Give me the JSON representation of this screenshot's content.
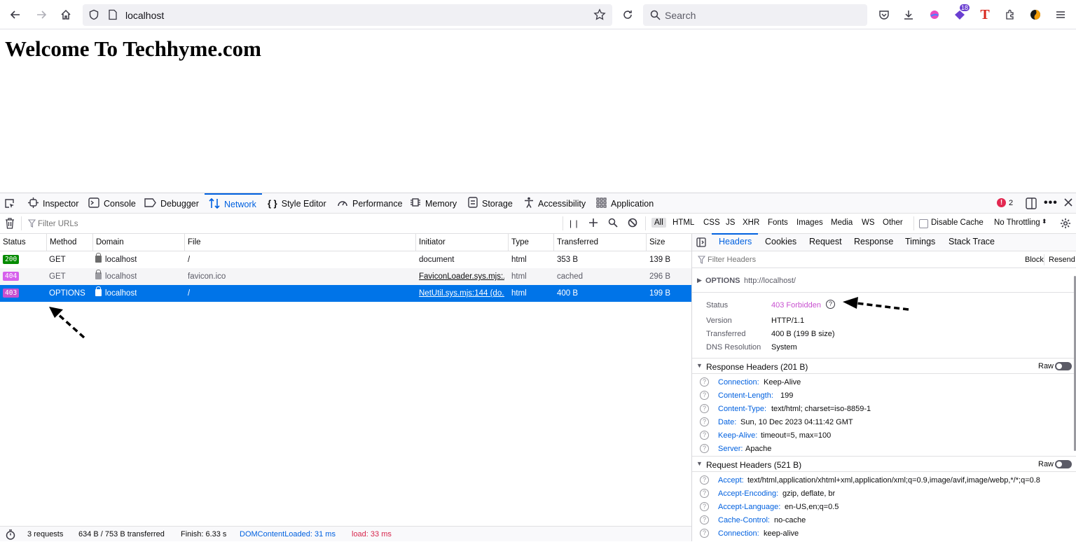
{
  "browser": {
    "url": "localhost",
    "search_placeholder": "Search",
    "ext_badge": "18",
    "ext_letter": "T"
  },
  "page": {
    "heading": "Welcome To Techhyme.com"
  },
  "devtools": {
    "tabs": [
      {
        "label": "Inspector"
      },
      {
        "label": "Console"
      },
      {
        "label": "Debugger"
      },
      {
        "label": "Network"
      },
      {
        "label": "Style Editor"
      },
      {
        "label": "Performance"
      },
      {
        "label": "Memory"
      },
      {
        "label": "Storage"
      },
      {
        "label": "Accessibility"
      },
      {
        "label": "Application"
      }
    ],
    "error_count": "2",
    "filter_placeholder": "Filter URLs",
    "type_filters": [
      "All",
      "HTML",
      "CSS",
      "JS",
      "XHR",
      "Fonts",
      "Images",
      "Media",
      "WS",
      "Other"
    ],
    "disable_cache": "Disable Cache",
    "throttling": "No Throttling",
    "columns": [
      "Status",
      "Method",
      "Domain",
      "File",
      "Initiator",
      "Type",
      "Transferred",
      "Size"
    ],
    "rows": [
      {
        "status": "200",
        "method": "GET",
        "domain": "localhost",
        "file": "/",
        "initiator": "document",
        "type": "html",
        "transferred": "353 B",
        "size": "139 B",
        "status_color": "#058b00"
      },
      {
        "status": "404",
        "method": "GET",
        "domain": "localhost",
        "file": "favicon.ico",
        "initiator": "FaviconLoader.sys.mjs:...",
        "type": "html",
        "transferred": "cached",
        "size": "296 B",
        "status_color": "#d660ec"
      },
      {
        "status": "403",
        "method": "OPTIONS",
        "domain": "localhost",
        "file": "/",
        "initiator": "NetUtil.sys.mjs:144 (do...",
        "type": "html",
        "transferred": "400 B",
        "size": "199 B",
        "status_color": "#c850d0"
      }
    ],
    "statusbar": {
      "requests": "3 requests",
      "transferred": "634 B / 753 B transferred",
      "finish": "Finish: 6.33 s",
      "dcl": "DOMContentLoaded: 31 ms",
      "load": "load: 33 ms"
    },
    "side": {
      "tabs": [
        "Headers",
        "Cookies",
        "Request",
        "Response",
        "Timings",
        "Stack Trace"
      ],
      "filter_placeholder": "Filter Headers",
      "block": "Block",
      "resend": "Resend",
      "summary_method": "OPTIONS",
      "summary_url": "http://localhost/",
      "status_label": "Status",
      "status_value": "403 Forbidden",
      "version_label": "Version",
      "version_value": "HTTP/1.1",
      "transferred_label": "Transferred",
      "transferred_value": "400 B (199 B size)",
      "dns_label": "DNS Resolution",
      "dns_value": "System",
      "response_title": "Response Headers (201 B)",
      "raw": "Raw",
      "response_headers": [
        {
          "k": "Connection:",
          "v": "Keep-Alive"
        },
        {
          "k": "Content-Length:",
          "v": "199"
        },
        {
          "k": "Content-Type:",
          "v": "text/html; charset=iso-8859-1"
        },
        {
          "k": "Date:",
          "v": "Sun, 10 Dec 2023 04:11:42 GMT"
        },
        {
          "k": "Keep-Alive:",
          "v": "timeout=5, max=100"
        },
        {
          "k": "Server:",
          "v": "Apache"
        }
      ],
      "request_title": "Request Headers (521 B)",
      "request_headers": [
        {
          "k": "Accept:",
          "v": "text/html,application/xhtml+xml,application/xml;q=0.9,image/avif,image/webp,*/*;q=0.8"
        },
        {
          "k": "Accept-Encoding:",
          "v": "gzip, deflate, br"
        },
        {
          "k": "Accept-Language:",
          "v": "en-US,en;q=0.5"
        },
        {
          "k": "Cache-Control:",
          "v": "no-cache"
        },
        {
          "k": "Connection:",
          "v": "keep-alive"
        }
      ]
    }
  }
}
